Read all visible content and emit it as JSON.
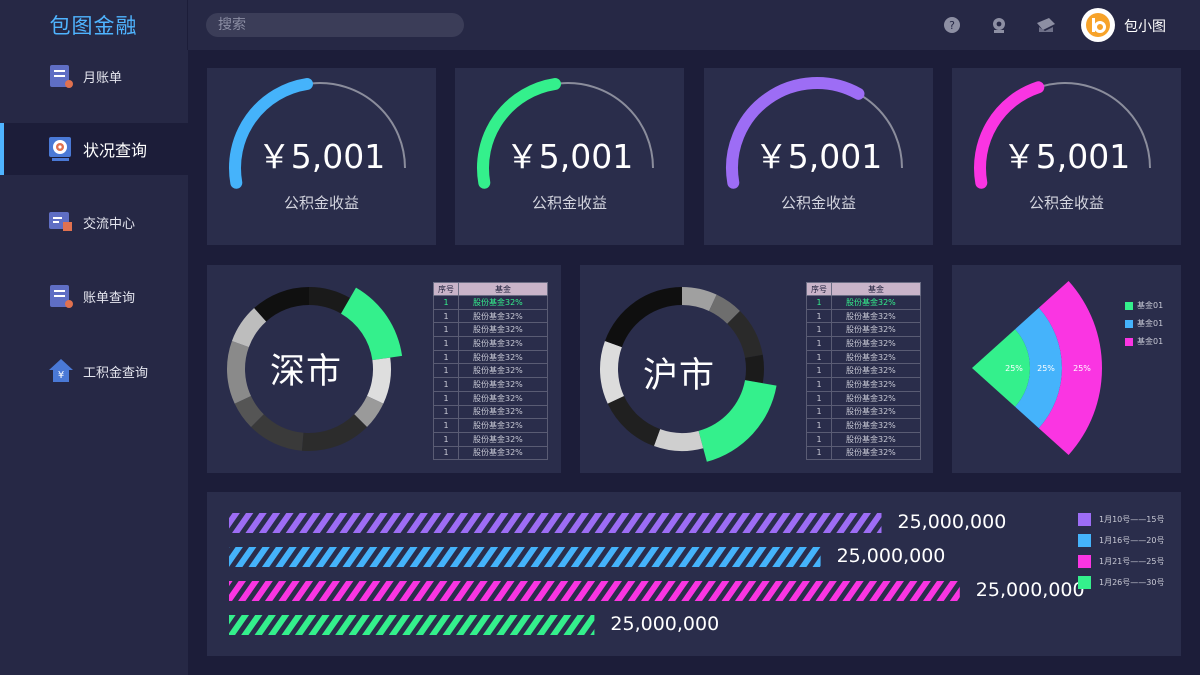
{
  "app": {
    "title": "包图金融"
  },
  "search": {
    "placeholder": "搜索"
  },
  "user": {
    "name": "包小图",
    "avatar_letter": "b"
  },
  "sidebar": {
    "items": [
      {
        "label": "月账单",
        "icon": "bill-icon",
        "active": false
      },
      {
        "label": "状况查询",
        "icon": "target-icon",
        "active": true
      },
      {
        "label": "交流中心",
        "icon": "chat-icon",
        "active": false
      },
      {
        "label": "账单查询",
        "icon": "bill-icon",
        "active": false
      },
      {
        "label": "工积金查询",
        "icon": "yen-house-icon",
        "active": false
      }
    ]
  },
  "colors": {
    "blue": "#45b3fb",
    "green": "#34f08c",
    "purple": "#9d6df5",
    "magenta": "#fa35e2",
    "card": "#2a2d4b",
    "accent": "#4fb4ff"
  },
  "gauges": [
    {
      "value": "￥5,001",
      "label": "公积金收益",
      "color": "#45b3fb",
      "fraction": 0.48
    },
    {
      "value": "￥5,001",
      "label": "公积金收益",
      "color": "#34f08c",
      "fraction": 0.48
    },
    {
      "value": "￥5,001",
      "label": "公积金收益",
      "color": "#9d6df5",
      "fraction": 0.68
    },
    {
      "value": "￥5,001",
      "label": "公积金收益",
      "color": "#fa35e2",
      "fraction": 0.43
    }
  ],
  "shenzhen": {
    "title": "深市",
    "table": {
      "headers": [
        "序号",
        "基金"
      ],
      "rows": [
        [
          "1",
          "股份基金32%"
        ],
        [
          "1",
          "股份基金32%"
        ],
        [
          "1",
          "股份基金32%"
        ],
        [
          "1",
          "股份基金32%"
        ],
        [
          "1",
          "股份基金32%"
        ],
        [
          "1",
          "股份基金32%"
        ],
        [
          "1",
          "股份基金32%"
        ],
        [
          "1",
          "股份基金32%"
        ],
        [
          "1",
          "股份基金32%"
        ],
        [
          "1",
          "股份基金32%"
        ],
        [
          "1",
          "股份基金32%"
        ],
        [
          "1",
          "股份基金32%"
        ]
      ]
    }
  },
  "shanghai": {
    "title": "沪市",
    "table": {
      "headers": [
        "序号",
        "基金"
      ],
      "rows": [
        [
          "1",
          "股份基金32%"
        ],
        [
          "1",
          "股份基金32%"
        ],
        [
          "1",
          "股份基金32%"
        ],
        [
          "1",
          "股份基金32%"
        ],
        [
          "1",
          "股份基金32%"
        ],
        [
          "1",
          "股份基金32%"
        ],
        [
          "1",
          "股份基金32%"
        ],
        [
          "1",
          "股份基金32%"
        ],
        [
          "1",
          "股份基金32%"
        ],
        [
          "1",
          "股份基金32%"
        ],
        [
          "1",
          "股份基金32%"
        ],
        [
          "1",
          "股份基金32%"
        ]
      ]
    }
  },
  "chart_data": [
    {
      "type": "pie",
      "title": "",
      "slices": [
        {
          "label": "",
          "value": 25,
          "color": "#34f08c"
        },
        {
          "label": "",
          "value": 25,
          "color": "#45b3fb"
        },
        {
          "label": "",
          "value": 25,
          "color": "#fa35e2"
        }
      ],
      "data_labels": [
        "25%",
        "25%",
        "25%"
      ],
      "legend": [
        "基金01",
        "基金01",
        "基金01"
      ],
      "legend_placement": "top-right"
    },
    {
      "type": "bar",
      "orientation": "horizontal",
      "title": "",
      "categories": [
        "1月10号——15号",
        "1月16号——20号",
        "1月21号——25号",
        "1月26号——30号"
      ],
      "values": [
        25000000,
        25000000,
        25000000,
        25000000
      ],
      "data_labels": [
        "25,000,000",
        "25,000,000",
        "25,000,000",
        "25,000,000"
      ],
      "bar_fill_fraction": [
        0.75,
        0.68,
        0.84,
        0.42
      ],
      "colors": [
        "#9d6df5",
        "#45b3fb",
        "#fa35e2",
        "#34f08c"
      ],
      "legend_placement": "right"
    }
  ]
}
